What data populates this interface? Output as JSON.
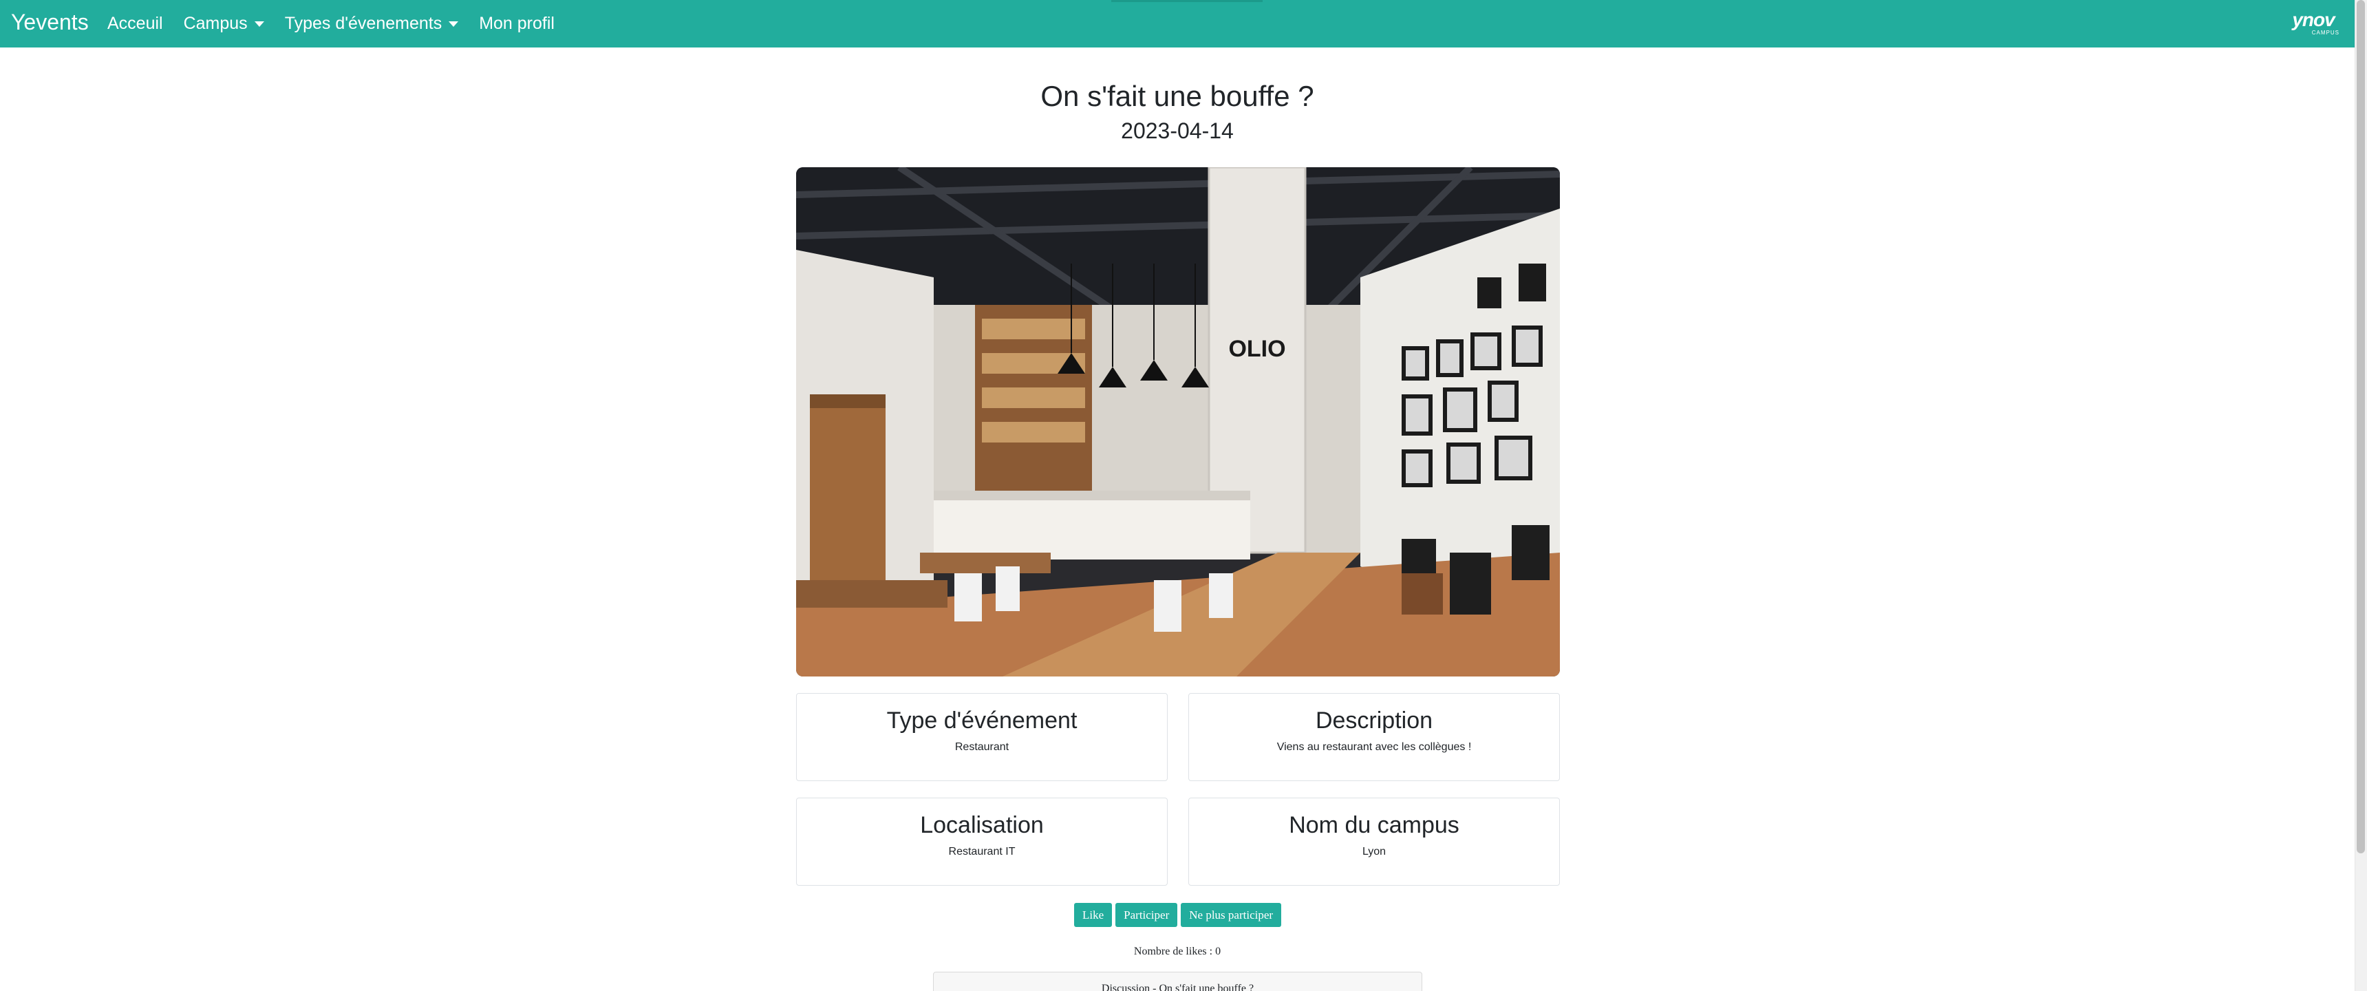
{
  "navbar": {
    "brand": "Yevents",
    "links": [
      {
        "label": "Acceuil"
      },
      {
        "label": "Campus"
      },
      {
        "label": "Types d'évenements"
      },
      {
        "label": "Mon profil"
      }
    ],
    "logo": {
      "main": "ynov",
      "sub": "CAMPUS"
    },
    "color": "#22ad9d"
  },
  "event": {
    "title": "On s'fait une bouffe ?",
    "date": "2023-04-14",
    "image_alt": "restaurant-interior-photo",
    "image_sign": "OLIO"
  },
  "cards": [
    {
      "title": "Type d'événement",
      "text": "Restaurant"
    },
    {
      "title": "Description",
      "text": "Viens au restaurant avec les collègues !"
    },
    {
      "title": "Localisation",
      "text": "Restaurant IT"
    },
    {
      "title": "Nom du campus",
      "text": "Lyon"
    }
  ],
  "actions": {
    "like": "Like",
    "participate": "Participer",
    "unparticipate": "Ne plus participer"
  },
  "likes_text": "Nombre de likes : 0",
  "discussion_title": "Discussion - On s'fait une bouffe ?"
}
